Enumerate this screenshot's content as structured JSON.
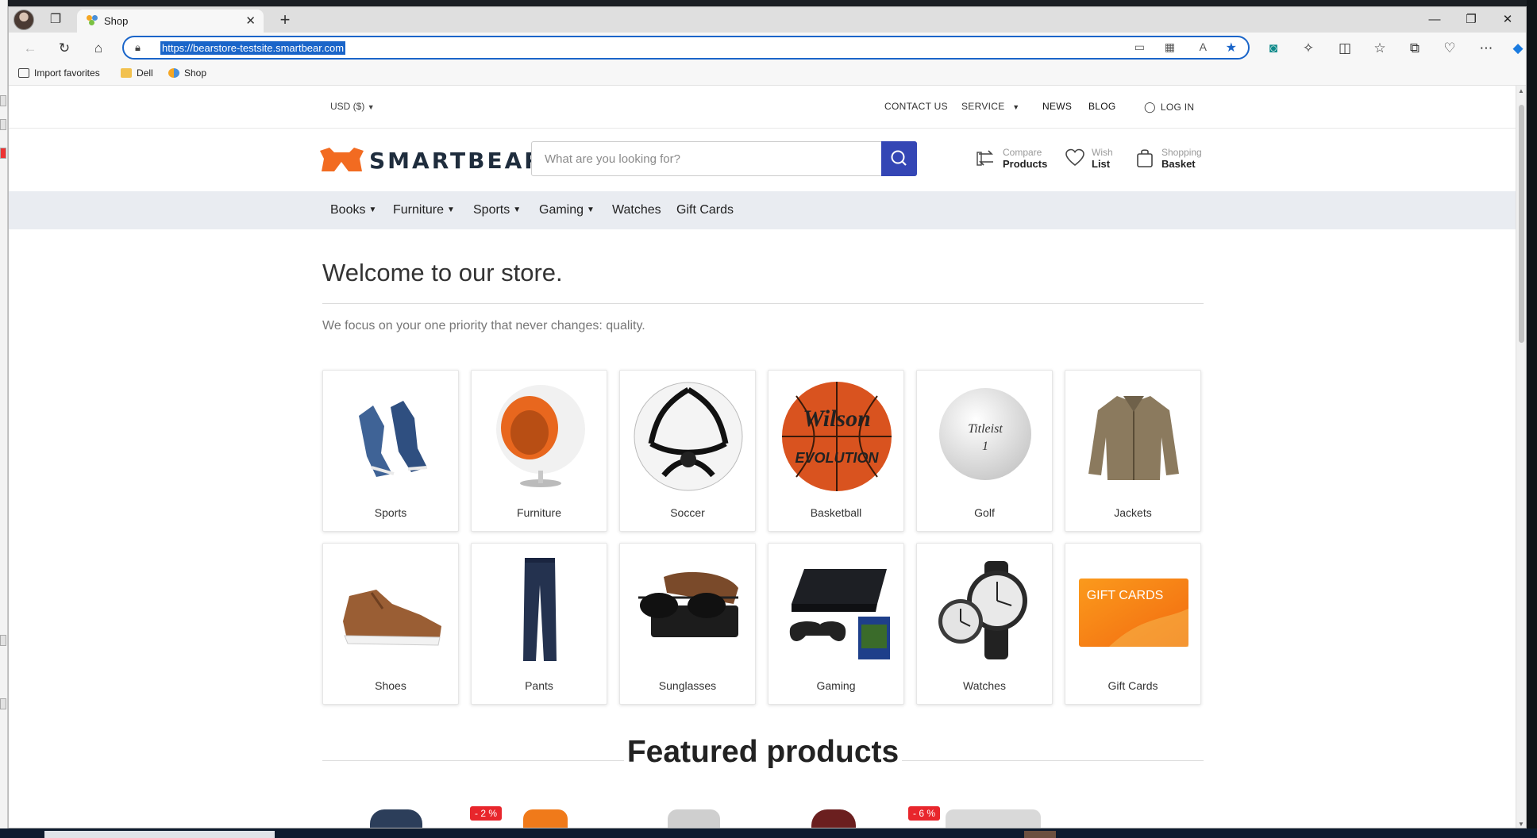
{
  "browser": {
    "tab_title": "Shop",
    "url": "https://bearstore-testsite.smartbear.com",
    "favorites": [
      "Import favorites",
      "Dell",
      "Shop"
    ]
  },
  "topbar": {
    "currency": "USD  ($)",
    "links": [
      "CONTACT US",
      "SERVICE",
      "NEWS",
      "BLOG"
    ],
    "login": "LOG IN"
  },
  "header": {
    "logo_text": "SMARTBEAR",
    "search_placeholder": "What are you looking for?",
    "compare_label": "Compare",
    "compare_strong": "Products",
    "wish_label": "Wish",
    "wish_strong": "List",
    "basket_label": "Shopping",
    "basket_strong": "Basket"
  },
  "nav": {
    "items": [
      {
        "label": "Books",
        "dropdown": true
      },
      {
        "label": "Furniture",
        "dropdown": true
      },
      {
        "label": "Sports",
        "dropdown": true
      },
      {
        "label": "Gaming",
        "dropdown": true
      },
      {
        "label": "Watches",
        "dropdown": false
      },
      {
        "label": "Gift Cards",
        "dropdown": false
      }
    ]
  },
  "main": {
    "welcome_title": "Welcome to our store.",
    "welcome_text": "We focus on your one priority that never changes: quality.",
    "categories": [
      "Sports",
      "Furniture",
      "Soccer",
      "Basketball",
      "Golf",
      "Jackets",
      "Shoes",
      "Pants",
      "Sunglasses",
      "Gaming",
      "Watches",
      "Gift Cards"
    ],
    "image_text": {
      "basketball_brand": "Wilson",
      "basketball_model": "EVOLUTION",
      "golf_brand": "Titleist",
      "giftcard_text": "GIFT CARDS"
    },
    "featured_title": "Featured products",
    "badges": [
      "- 2 %",
      "- 6 %"
    ]
  },
  "colors": {
    "accent": "#3446b5",
    "brand_orange": "#f26b21",
    "badge_red": "#e8262c",
    "nav_bg": "#e9ecf1"
  }
}
